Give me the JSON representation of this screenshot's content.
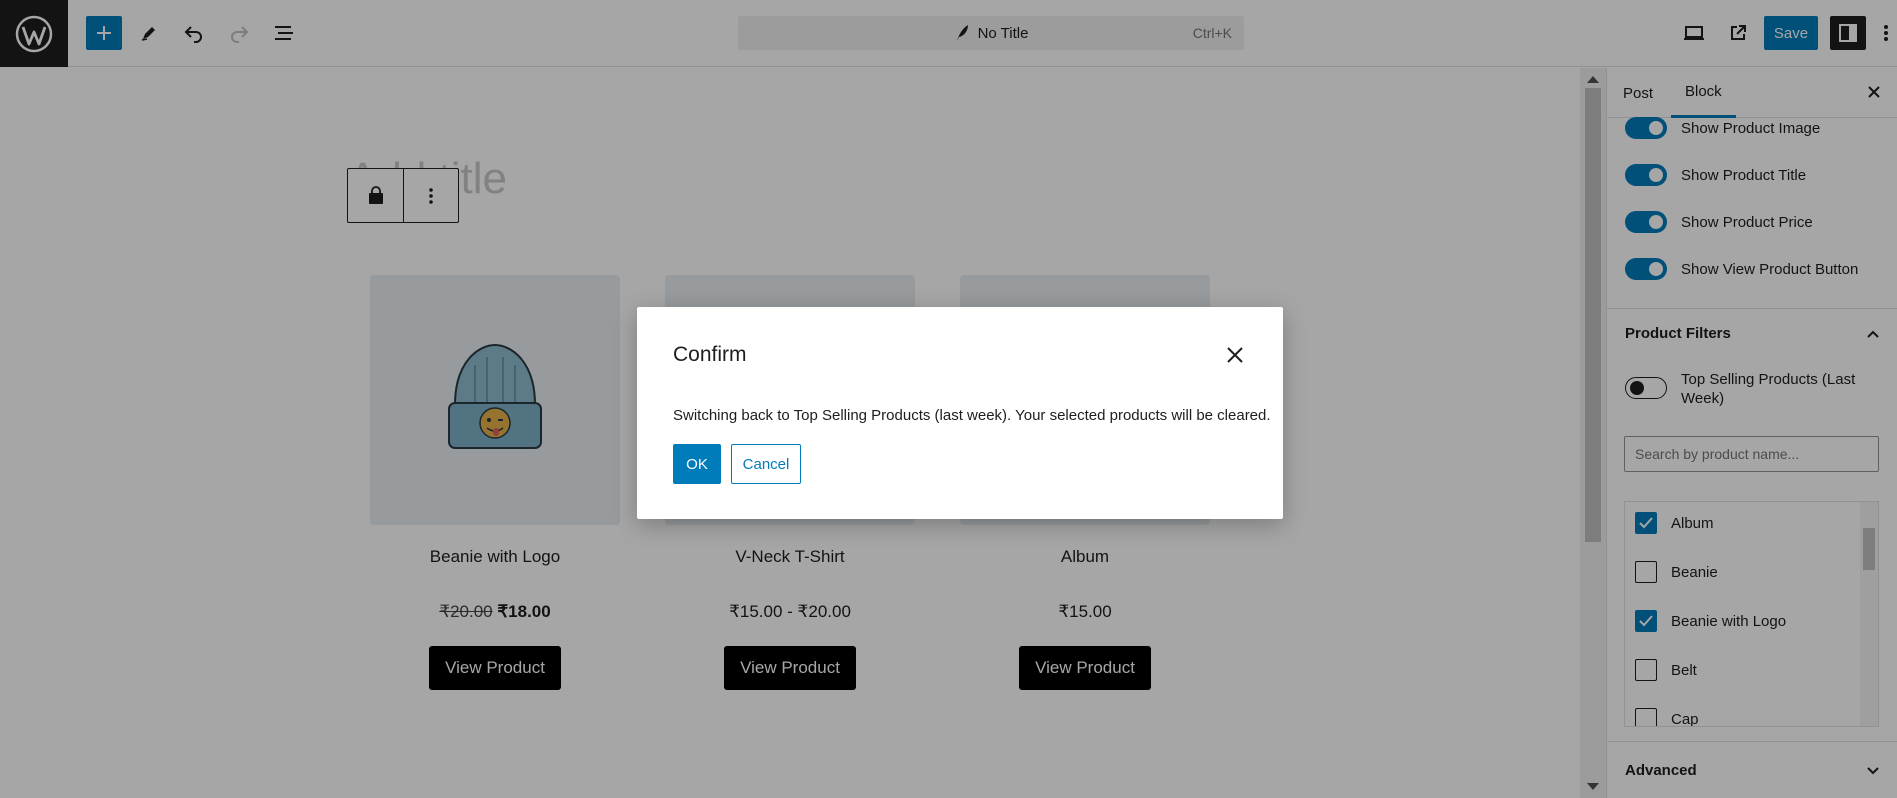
{
  "topbar": {
    "doc_title": "No Title",
    "shortcut": "Ctrl+K",
    "save_label": "Save"
  },
  "canvas": {
    "title_placeholder": "Add title",
    "products": [
      {
        "name": "Beanie with Logo",
        "old_price": "₹20.00",
        "price": "₹18.00",
        "button": "View Product"
      },
      {
        "name": "V-Neck T-Shirt",
        "old_price": "",
        "price": "₹15.00 - ₹20.00",
        "button": "View Product"
      },
      {
        "name": "Album",
        "old_price": "",
        "price": "₹15.00",
        "button": "View Product"
      }
    ]
  },
  "sidebar": {
    "tabs": [
      {
        "label": "Post"
      },
      {
        "label": "Block"
      }
    ],
    "active_tab": "Block",
    "toggles": [
      {
        "label": "Show Product Image",
        "on": true
      },
      {
        "label": "Show Product Title",
        "on": true
      },
      {
        "label": "Show Product Price",
        "on": true
      },
      {
        "label": "Show View Product Button",
        "on": true
      }
    ],
    "filters_heading": "Product Filters",
    "top_selling_toggle": {
      "label": "Top Selling Products (Last Week)",
      "on": false
    },
    "search_placeholder": "Search by product name...",
    "products": [
      {
        "label": "Album",
        "checked": true
      },
      {
        "label": "Beanie",
        "checked": false
      },
      {
        "label": "Beanie with Logo",
        "checked": true
      },
      {
        "label": "Belt",
        "checked": false
      },
      {
        "label": "Cap",
        "checked": false
      }
    ],
    "advanced_heading": "Advanced"
  },
  "modal": {
    "title": "Confirm",
    "message": "Switching back to Top Selling Products (last week). Your selected products will be cleared.",
    "ok_label": "OK",
    "cancel_label": "Cancel"
  },
  "colors": {
    "accent": "#007cba",
    "dark": "#1e1e1e",
    "overlay": "rgba(0,0,0,0.35)"
  }
}
